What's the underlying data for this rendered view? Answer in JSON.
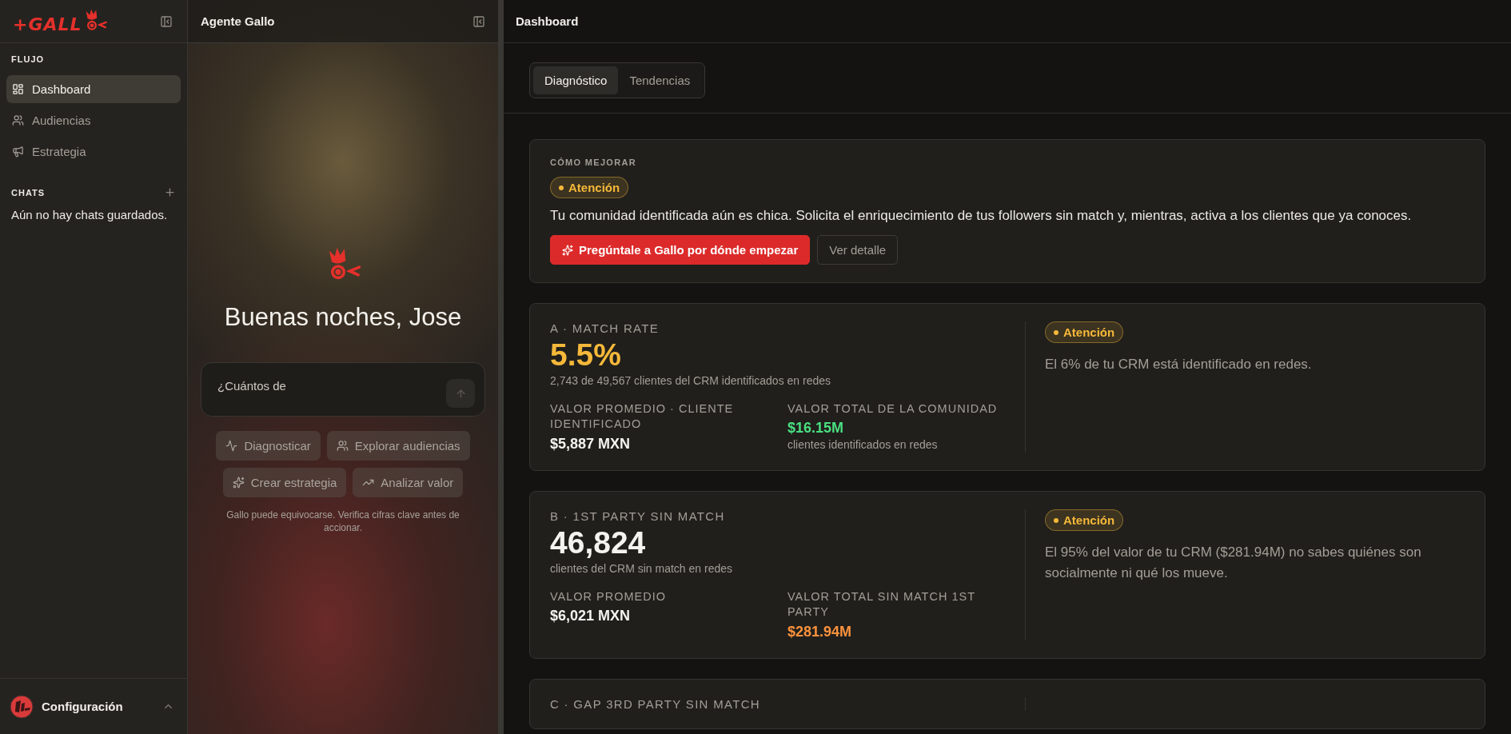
{
  "sidebar": {
    "logo_text": "+GALL",
    "sections": [
      {
        "title": "FLUJO",
        "items": [
          {
            "label": "Dashboard",
            "selected": true
          },
          {
            "label": "Audiencias",
            "selected": false
          },
          {
            "label": "Estrategia",
            "selected": false
          }
        ]
      }
    ],
    "chats": {
      "title": "CHATS",
      "empty": "Aún no hay chats guardados."
    },
    "footer": {
      "label": "Configuración"
    }
  },
  "chat_panel": {
    "title": "Agente Gallo",
    "greeting": "Buenas noches, Jose",
    "input": {
      "value": "¿Cuántos de"
    },
    "suggestions": [
      {
        "label": "Diagnosticar"
      },
      {
        "label": "Explorar audiencias"
      },
      {
        "label": "Crear estrategia"
      },
      {
        "label": "Analizar valor"
      }
    ],
    "disclaimer": "Gallo puede equivocarse. Verifica cifras clave antes de accionar."
  },
  "main": {
    "title": "Dashboard",
    "tabs": [
      {
        "label": "Diagnóstico",
        "selected": true
      },
      {
        "label": "Tendencias",
        "selected": false
      }
    ],
    "improve": {
      "title": "CÓMO MEJORAR",
      "status": {
        "label": "Atención",
        "color": "#f5b83a"
      },
      "text": "Tu comunidad identificada aún es chica. Solicita el enriquecimiento de tus followers sin match y, mientras, activa a los clientes que ya conoces.",
      "buttons": [
        {
          "label": "Pregúntale a Gallo por dónde empezar",
          "kind": "primary"
        },
        {
          "label": "Ver detalle",
          "kind": "secondary"
        }
      ]
    },
    "metrics": [
      {
        "title": "A · MATCH RATE",
        "value": "5.5%",
        "color": "#f5b83a",
        "subtitle": "2,743 de 49,567 clientes del CRM identificados en redes",
        "stats": [
          {
            "label": "VALOR PROMEDIO · CLIENTE IDENTIFICADO",
            "value": "$5,887 MXN",
            "color": "#f5f3ef"
          },
          {
            "label": "VALOR TOTAL DE LA COMUNIDAD",
            "value": "$16.15M",
            "color": "#4ade80",
            "note": "clientes identificados en redes"
          }
        ],
        "status": {
          "label": "Atención",
          "color": "#f5b83a"
        },
        "description": "El 6% de tu CRM está identificado en redes."
      },
      {
        "title": "B · 1ST PARTY SIN MATCH",
        "value": "46,824",
        "color": "#f5f3ef",
        "subtitle": "clientes del CRM sin match en redes",
        "stats": [
          {
            "label": "VALOR PROMEDIO",
            "value": "$6,021 MXN",
            "color": "#f5f3ef"
          },
          {
            "label": "VALOR TOTAL SIN MATCH 1ST PARTY",
            "value": "$281.94M",
            "color": "#fb923c"
          }
        ],
        "status": {
          "label": "Atención",
          "color": "#f5b83a"
        },
        "description": "El 95% del valor de tu CRM ($281.94M) no sabes quiénes son socialmente ni qué los mueve."
      },
      {
        "title": "C · GAP 3RD PARTY SIN MATCH"
      }
    ]
  }
}
